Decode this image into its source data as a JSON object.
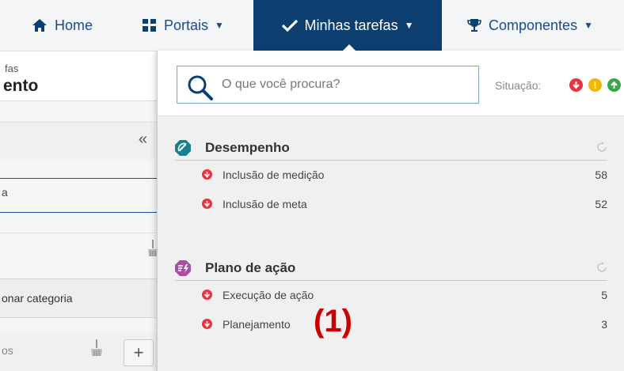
{
  "nav": {
    "home": "Home",
    "portais": "Portais",
    "tasks": "Minhas tarefas",
    "componentes": "Componentes"
  },
  "left_panel": {
    "breadcrumb": "fas",
    "title": "ento",
    "collapse": "«",
    "field2": "a",
    "category_button": "onar categoria",
    "footer_label": "os",
    "plus": "+"
  },
  "search": {
    "placeholder": "O que você procura?",
    "status_label": "Situação:"
  },
  "status_colors": {
    "late": "#e8333e",
    "warning": "#f2b705",
    "ok": "#3aa64a"
  },
  "sections": [
    {
      "title": "Desempenho",
      "icon": "performance-gauge-icon",
      "color": "#16808e",
      "items": [
        {
          "label": "Inclusão de medição",
          "count": "58"
        },
        {
          "label": "Inclusão de meta",
          "count": "52"
        }
      ]
    },
    {
      "title": "Plano de ação",
      "icon": "action-plan-icon",
      "color": "#a64fa3",
      "items": [
        {
          "label": "Execução de ação",
          "count": "5"
        },
        {
          "label": "Planejamento",
          "count": "3"
        }
      ]
    }
  ],
  "annotation": "(1)"
}
